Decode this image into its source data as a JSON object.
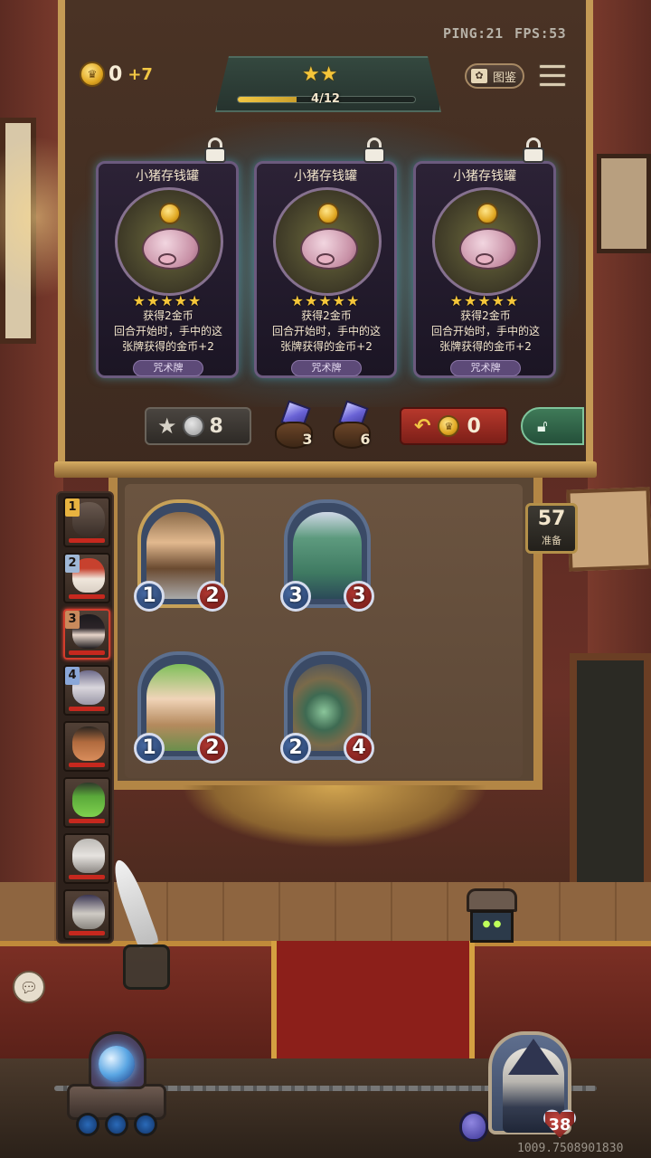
{
  "hud": {
    "ping": "PING:21",
    "fps": "FPS:53",
    "gold": "0",
    "gold_income": "+7",
    "tier_stars": "★★",
    "tier_progress_text": "4/12",
    "tier_progress": 0.33,
    "codex_label": "图鉴"
  },
  "shop": {
    "cards": [
      {
        "name": "小猪存钱罐",
        "stars": "★★★★★",
        "desc_line1": "获得2金币",
        "desc_line2": "回合开始时，手中的这",
        "desc_line3": "张牌获得的金币+2",
        "type": "咒术牌"
      },
      {
        "name": "小猪存钱罐",
        "stars": "★★★★★",
        "desc_line1": "获得2金币",
        "desc_line2": "回合开始时，手中的这",
        "desc_line3": "张牌获得的金币+2",
        "type": "咒术牌"
      },
      {
        "name": "小猪存钱罐",
        "stars": "★★★★★",
        "desc_line1": "获得2金币",
        "desc_line2": "回合开始时，手中的这",
        "desc_line3": "张牌获得的金币+2",
        "type": "咒术牌"
      }
    ],
    "upgrade_cost": "8",
    "gem_small_count": "3",
    "gem_large_count": "6",
    "refresh_cost": "0"
  },
  "timer": {
    "value": "57",
    "label": "准备"
  },
  "roster": {
    "ranks": [
      "1",
      "2",
      "3",
      "4"
    ]
  },
  "board": {
    "minions": [
      {
        "attack": "1",
        "health": "2"
      },
      {
        "attack": "3",
        "health": "3"
      },
      {
        "attack": "1",
        "health": "2"
      },
      {
        "attack": "2",
        "health": "4"
      }
    ]
  },
  "hero": {
    "health": "38"
  },
  "footer": {
    "uid": "1009.7508901830"
  },
  "colors": {
    "gold": "#f2c744",
    "health_red": "#c6281e",
    "attack_blue": "#4b6ea8",
    "shop_glow": "#5ebed6"
  }
}
